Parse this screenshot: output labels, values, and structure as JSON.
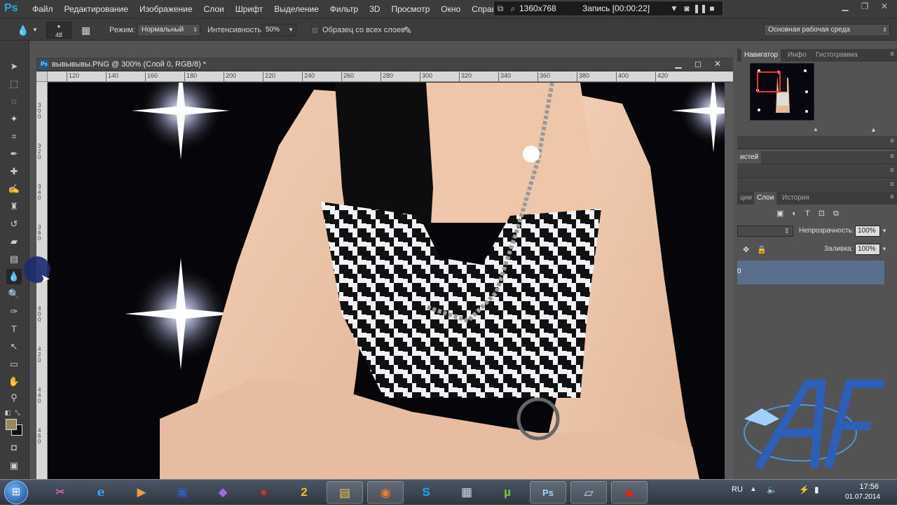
{
  "menubar": {
    "logo": "Ps",
    "items": [
      "Файл",
      "Редактирование",
      "Изображение",
      "Слои",
      "Шрифт",
      "Выделение",
      "Фильтр",
      "3D",
      "Просмотр",
      "Окно",
      "Справка"
    ]
  },
  "recorder": {
    "resolution": "1360x768",
    "status": "Запись [00:00:22]"
  },
  "options": {
    "brush_size": "48",
    "mode_label": "Режим:",
    "mode_value": "Нормальный",
    "intensity_label": "Интенсивность:",
    "intensity_value": "50%",
    "sample_all_label": "Образец со всех слоев",
    "workspace": "Основная рабочая среда"
  },
  "document": {
    "title": "вывывывы.PNG @ 300% (Слой 0, RGB/8) *",
    "h_ruler": [
      "120",
      "140",
      "160",
      "180",
      "200",
      "220",
      "240",
      "260",
      "280",
      "300",
      "320",
      "340",
      "360",
      "380",
      "400",
      "420"
    ],
    "v_ruler": [
      "300",
      "320",
      "340",
      "360",
      "380",
      "400",
      "420",
      "440",
      "460"
    ]
  },
  "panels": {
    "navigator_tab": "Навигатор",
    "info_tab": "Инфо",
    "histogram_tab": "Гистограмма",
    "brushes_tab": "истей",
    "channels_tab": "ции",
    "layers_tab": "Слои",
    "history_tab": "История",
    "opacity_label": "Непрозрачность:",
    "opacity_value": "100%",
    "fill_label": "Заливка:",
    "fill_value": "100%",
    "layer_name": "0"
  },
  "taskbar": {
    "lang": "RU",
    "time": "17:56",
    "date": "01.07.2014",
    "apps": [
      {
        "name": "paint-icon",
        "glyph": "✂"
      },
      {
        "name": "ie-icon",
        "glyph": "e"
      },
      {
        "name": "media-player-icon",
        "glyph": "▶"
      },
      {
        "name": "save-disk-icon",
        "glyph": "▣"
      },
      {
        "name": "visual-studio-icon",
        "glyph": "◆"
      },
      {
        "name": "recorder-app-icon",
        "glyph": "●"
      },
      {
        "name": "games-icon",
        "glyph": "2"
      },
      {
        "name": "explorer-icon",
        "glyph": "▤"
      },
      {
        "name": "firefox-icon",
        "glyph": "◉"
      },
      {
        "name": "skype-icon",
        "glyph": "S"
      },
      {
        "name": "calculator-icon",
        "glyph": "▦"
      },
      {
        "name": "utorrent-icon",
        "glyph": "µ"
      },
      {
        "name": "photoshop-icon",
        "glyph": "Ps"
      },
      {
        "name": "notes-icon",
        "glyph": "▱"
      },
      {
        "name": "record-icon",
        "glyph": "●"
      }
    ]
  },
  "colors": {
    "foreground": "#968a5c",
    "background": "#111111",
    "layer_selected": "#5a6f8e"
  }
}
